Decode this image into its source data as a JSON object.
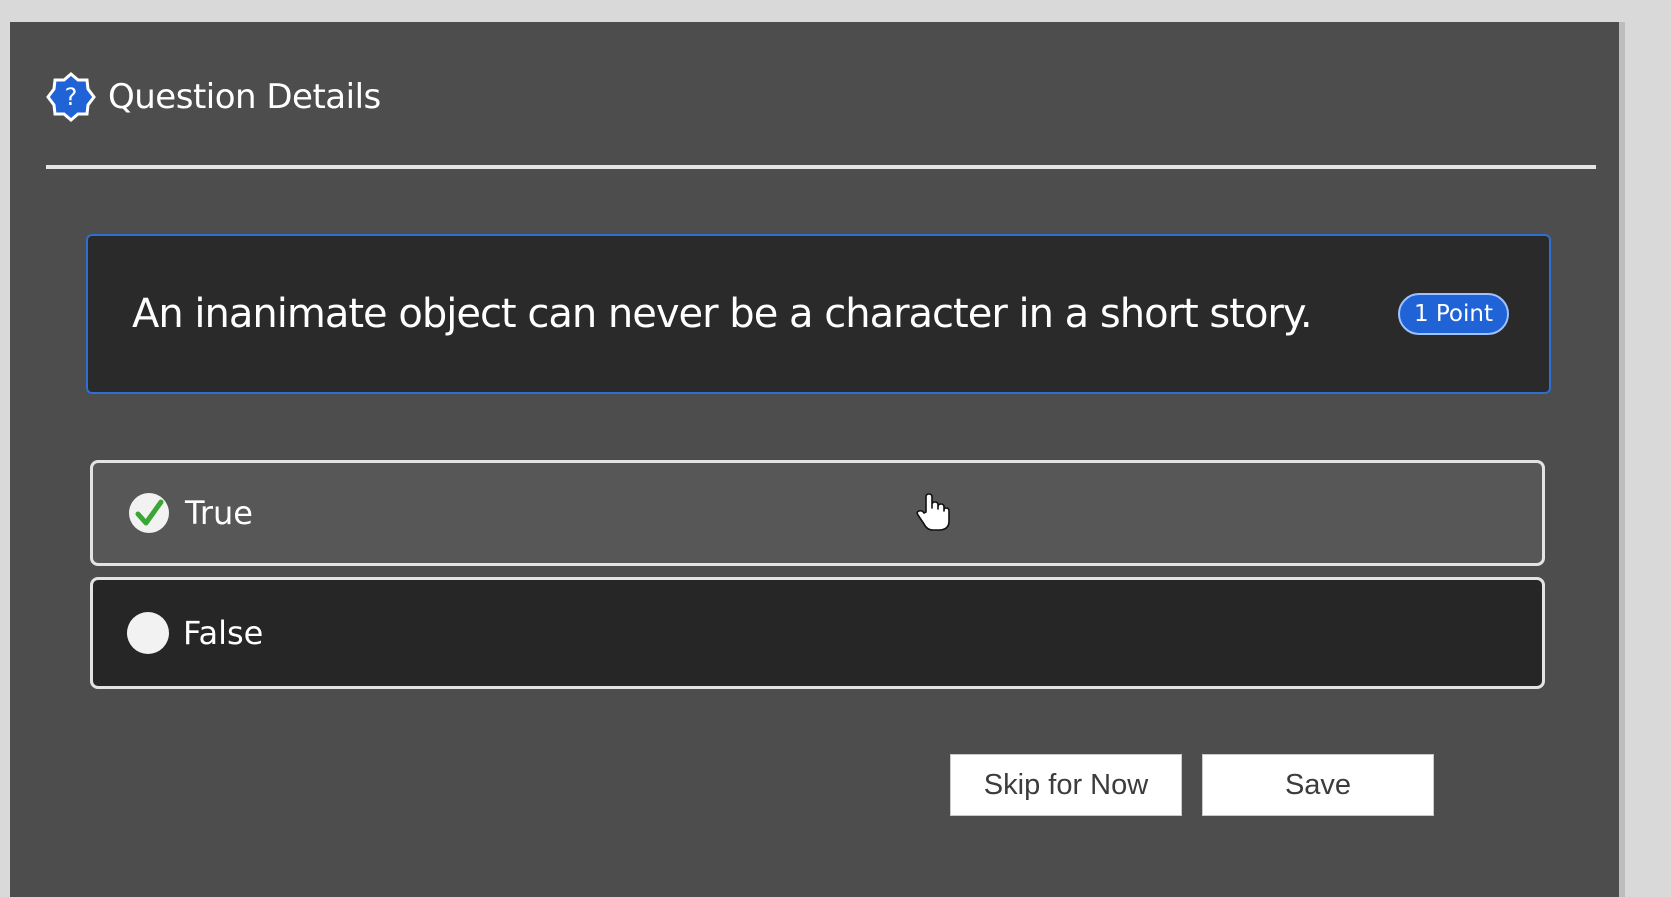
{
  "header": {
    "title": "Question Details",
    "icon": "question-badge-icon"
  },
  "question": {
    "text": "An inanimate object can never be a character in a short story.",
    "points": "1 Point"
  },
  "options": [
    {
      "label": "True",
      "selected": true,
      "icon": "check-circle-icon"
    },
    {
      "label": "False",
      "selected": false,
      "icon": "radio-empty-icon"
    }
  ],
  "buttons": {
    "skip_label": "Skip for Now",
    "save_label": "Save"
  },
  "colors": {
    "accent": "#1f63d6",
    "check": "#3aa635",
    "panel": "#4d4d4d"
  }
}
